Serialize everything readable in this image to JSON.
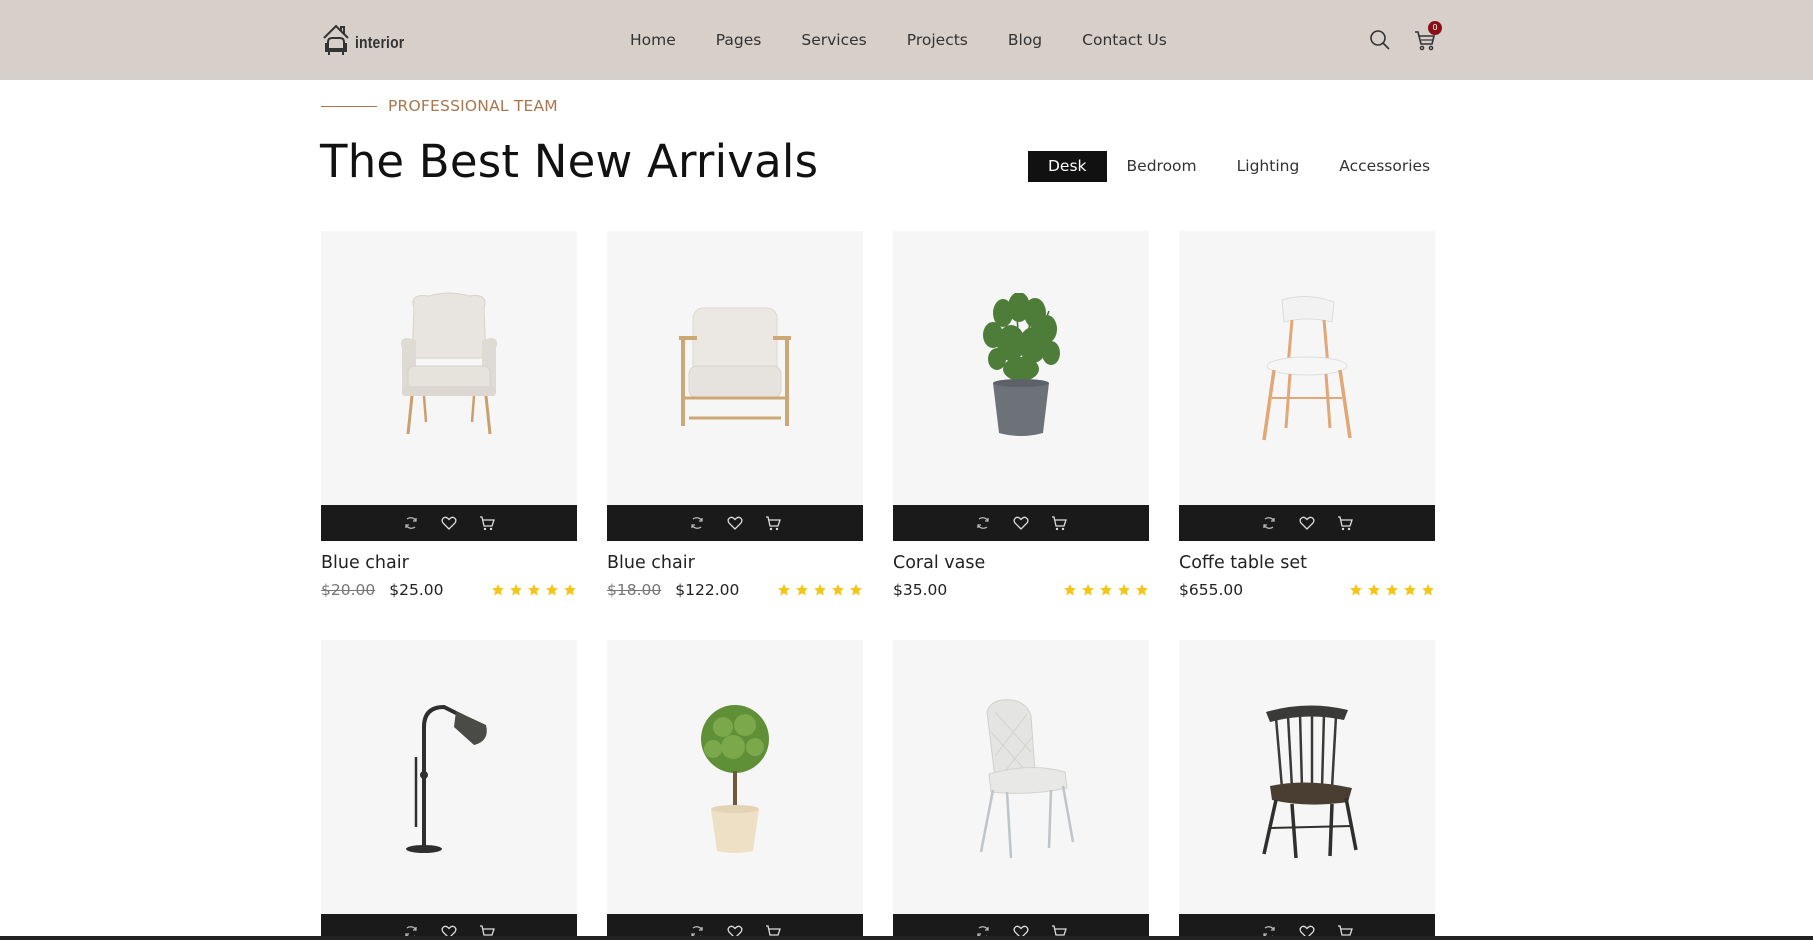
{
  "logo": {
    "text": "interior"
  },
  "nav": {
    "items": [
      "Home",
      "Pages",
      "Services",
      "Projects",
      "Blog",
      "Contact Us"
    ]
  },
  "cart": {
    "count": "0"
  },
  "section": {
    "eyebrow": "PROFESSIONAL TEAM",
    "title": "The Best New Arrivals"
  },
  "filters": {
    "tabs": [
      "Desk",
      "Bedroom",
      "Lighting",
      "Accessories"
    ],
    "active": "Desk"
  },
  "products": [
    {
      "name": "Blue chair",
      "old_price": "$20.00",
      "price": "$25.00",
      "rating": 5,
      "image": "wingback-armchair"
    },
    {
      "name": "Blue chair",
      "old_price": "$18.00",
      "price": "$122.00",
      "rating": 5,
      "image": "wood-frame-armchair"
    },
    {
      "name": "Coral vase",
      "old_price": "",
      "price": "$35.00",
      "rating": 5,
      "image": "potted-plant"
    },
    {
      "name": "Coffe table set",
      "old_price": "",
      "price": "$655.00",
      "rating": 5,
      "image": "white-chair"
    },
    {
      "name": "",
      "old_price": "",
      "price": "",
      "rating": 0,
      "image": "floor-lamp"
    },
    {
      "name": "",
      "old_price": "",
      "price": "",
      "rating": 0,
      "image": "topiary-tree"
    },
    {
      "name": "",
      "old_price": "",
      "price": "",
      "rating": 0,
      "image": "quilted-chair"
    },
    {
      "name": "",
      "old_price": "",
      "price": "",
      "rating": 0,
      "image": "windsor-chair"
    }
  ],
  "colors": {
    "header_bg": "#d6cfca",
    "accent": "#a8774f",
    "star": "#f5c518",
    "bar": "#1a1a1a",
    "badge": "#8b0f16"
  },
  "icons": [
    "house-logo-icon",
    "search-icon",
    "cart-icon",
    "refresh-icon",
    "heart-icon",
    "cart-icon",
    "star-icon"
  ]
}
